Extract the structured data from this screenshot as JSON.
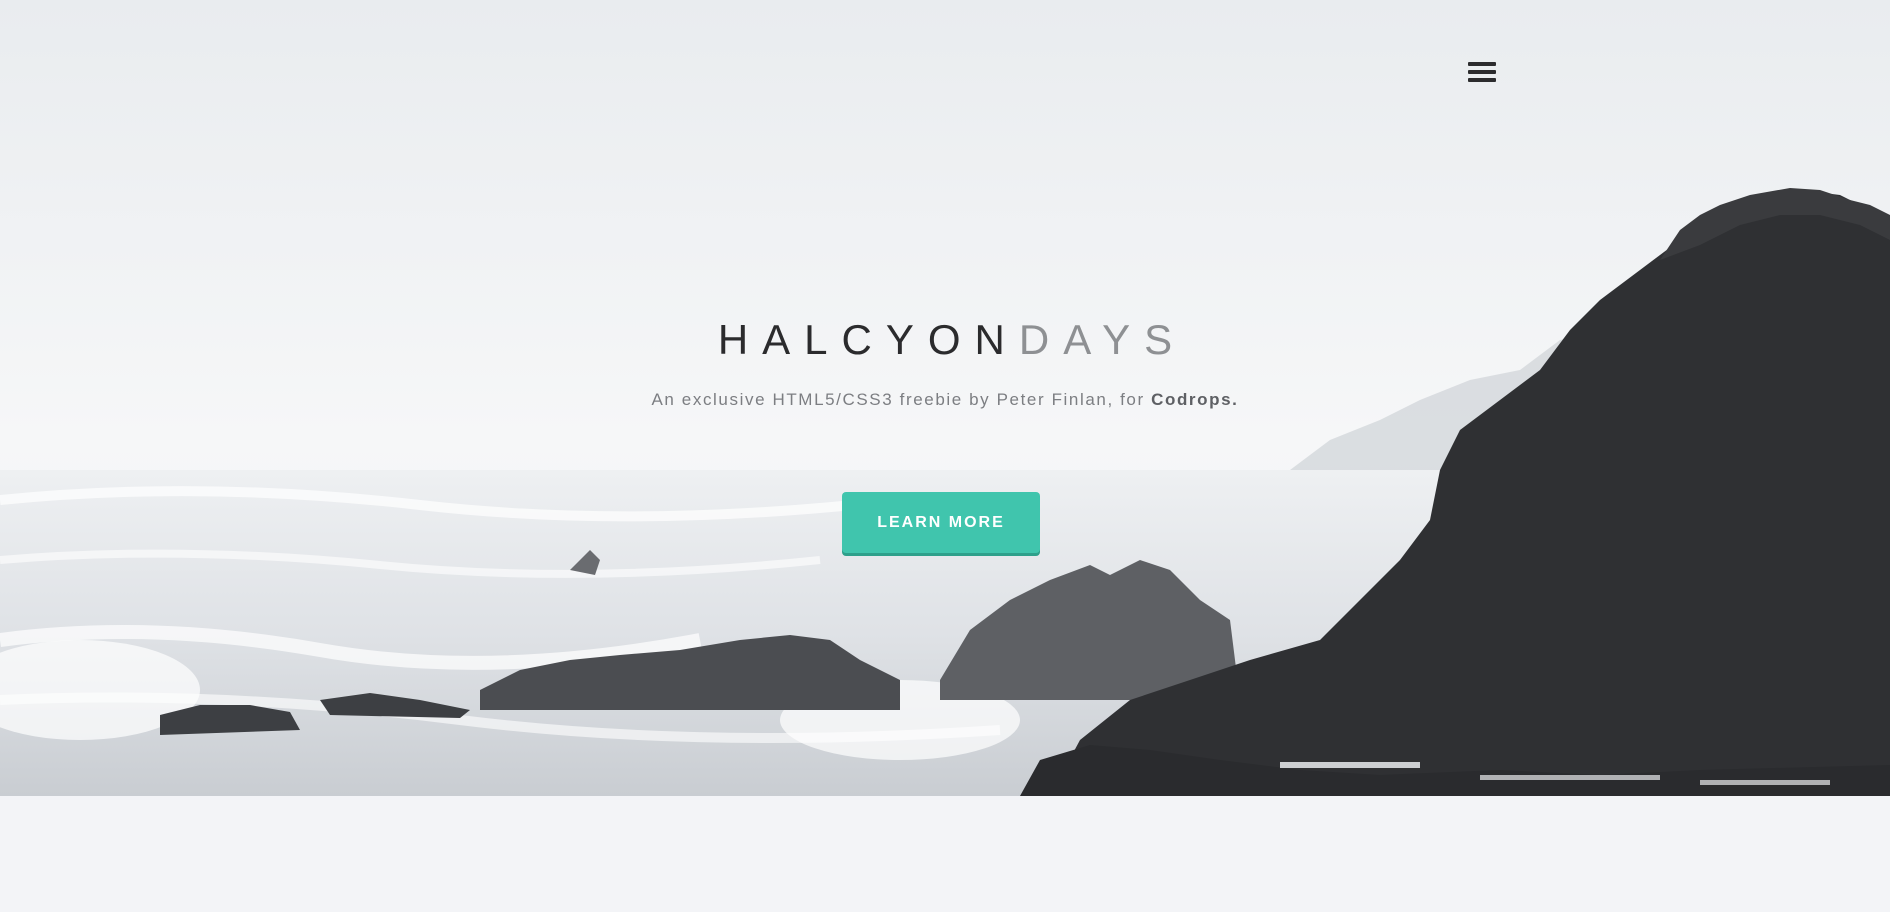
{
  "header": {
    "menu_icon": "hamburger-menu-icon"
  },
  "hero": {
    "title_part1": "HALCYON",
    "title_part2": "DAYS",
    "subtitle_prefix": "An exclusive HTML5/CSS3 freebie by Peter Finlan, for ",
    "subtitle_link": "Codrops.",
    "cta_label": "LEARN MORE"
  },
  "colors": {
    "accent": "#40c5ad",
    "title_dark": "#2b2b2d",
    "title_light": "#8e9093",
    "page_background": "#f3f4f7"
  }
}
